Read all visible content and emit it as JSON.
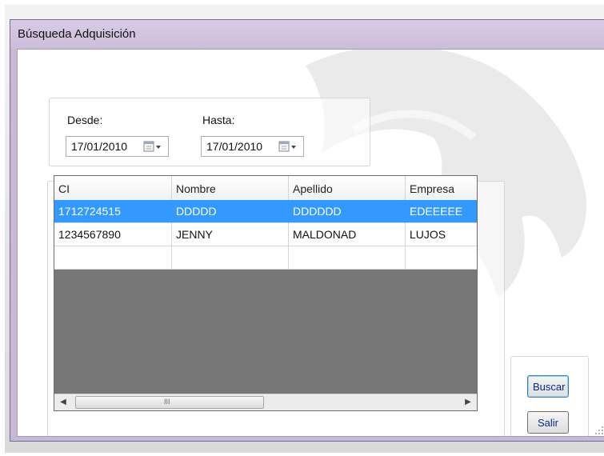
{
  "window": {
    "title": "Búsqueda Adquisición"
  },
  "dates": {
    "from_label": "Desde:",
    "from_value": "17/01/2010",
    "to_label": "Hasta:",
    "to_value": "17/01/2010"
  },
  "grid": {
    "columns": [
      "CI",
      "Nombre",
      "Apellido",
      "Empresa"
    ],
    "rows": [
      [
        "1712724515",
        "DDDDD",
        "DDDDDD",
        "EDEEEEE"
      ],
      [
        "1234567890",
        "JENNY",
        "MALDONAD",
        "LUJOS"
      ],
      [
        "",
        "",
        "",
        ""
      ]
    ],
    "selected_row": 0,
    "scroll_grip": "III"
  },
  "buttons": {
    "search_label": "Buscar",
    "exit_label": "Salir"
  },
  "colors": {
    "selection": "#3399ff",
    "window_frame": "#c8b8d8",
    "grid_background": "#777777"
  },
  "icons": {
    "date_picker": "calendar-dropdown-icon",
    "scroll_left": "arrow-left-icon",
    "scroll_right": "arrow-right-icon"
  }
}
